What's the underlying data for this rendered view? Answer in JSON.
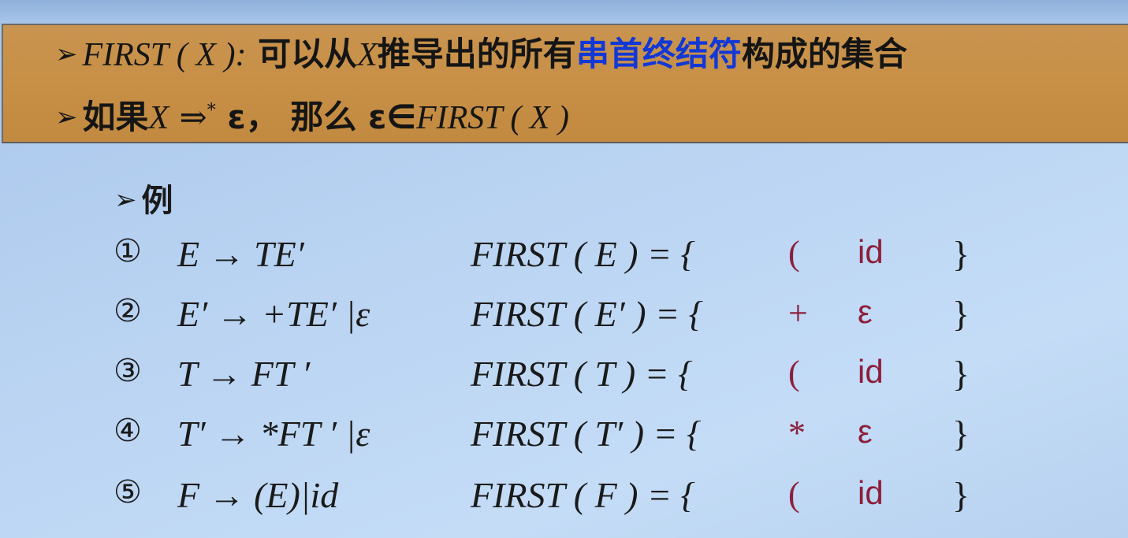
{
  "header": {
    "line1": {
      "marker": "➢",
      "term": "FIRST ( X ):",
      "text_before": " 可以从",
      "var": "X",
      "text_mid": "推导出的所有",
      "highlight": "串首终结符",
      "text_after": "构成的集合"
    },
    "line2": {
      "marker": "➢",
      "text_if": "如果",
      "var": "X",
      "derive": " ⇒",
      "star": "*",
      "eps_then": " ε， 那么 ε∈",
      "first_x": "FIRST ( X )"
    }
  },
  "example": {
    "marker": "➢",
    "label": "例"
  },
  "rules": [
    {
      "num": "①",
      "production": "E → TE′",
      "first": "FIRST ( E  ) = {",
      "sym1": "(",
      "sym2": "id",
      "close": "}"
    },
    {
      "num": "②",
      "production": "E′ → +TE′ |ε",
      "first": "FIRST ( E′ ) = {",
      "sym1": "+",
      "sym2": "ε",
      "close": "}"
    },
    {
      "num": "③",
      "production": "T → FT ′",
      "first": "FIRST ( T )  = {",
      "sym1": "(",
      "sym2": "id",
      "close": "}"
    },
    {
      "num": "④",
      "production": "T′ → *FT ′ |ε",
      "first": "FIRST ( T′ ) = {",
      "sym1": "*",
      "sym2": "ε",
      "close": "}"
    },
    {
      "num": "⑤",
      "production": "F → (E)|id",
      "first": "FIRST ( F )  = {",
      "sym1": "(",
      "sym2": "id",
      "close": "}"
    }
  ],
  "colors": {
    "header_bg": "#c78f45",
    "highlight": "#1238d6",
    "set_symbols": "#8c1f3b",
    "background": "#b9d3f2"
  }
}
